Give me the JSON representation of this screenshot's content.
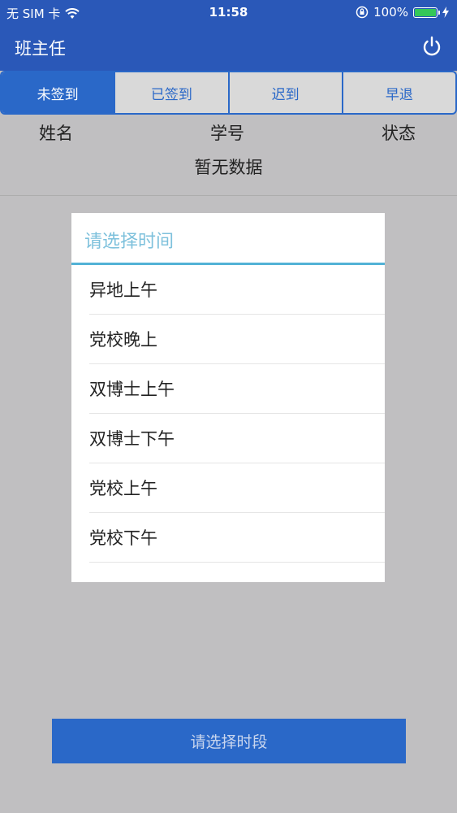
{
  "status_bar": {
    "carrier": "无 SIM 卡",
    "time": "11:58",
    "battery_percent": "100%"
  },
  "nav": {
    "title": "班主任"
  },
  "tabs": [
    {
      "label": "未签到",
      "active": true
    },
    {
      "label": "已签到",
      "active": false
    },
    {
      "label": "迟到",
      "active": false
    },
    {
      "label": "早退",
      "active": false
    }
  ],
  "table": {
    "headers": [
      "姓名",
      "学号",
      "状态"
    ],
    "empty_text": "暂无数据"
  },
  "dialog": {
    "title": "请选择时间",
    "options": [
      "异地上午",
      "党校晚上",
      "双博士上午",
      "双博士下午",
      "党校上午",
      "党校下午"
    ]
  },
  "bottom_button": {
    "label": "请选择时段"
  },
  "colors": {
    "nav_bg": "#2a58b8",
    "accent": "#2a68c8",
    "dialog_title": "#7ec1dc",
    "overlay_bg": "#c0bfc1"
  }
}
